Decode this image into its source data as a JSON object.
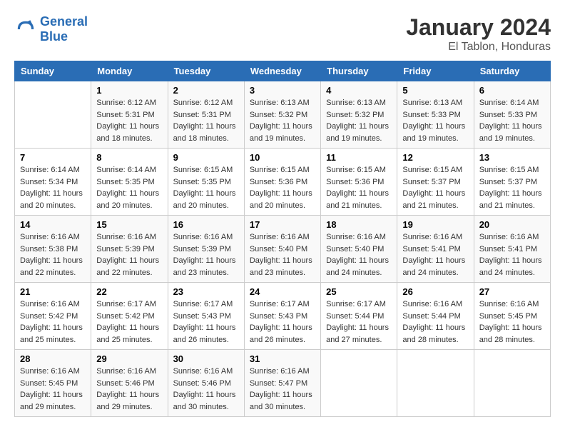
{
  "header": {
    "logo_line1": "General",
    "logo_line2": "Blue",
    "title": "January 2024",
    "subtitle": "El Tablon, Honduras"
  },
  "calendar": {
    "days_of_week": [
      "Sunday",
      "Monday",
      "Tuesday",
      "Wednesday",
      "Thursday",
      "Friday",
      "Saturday"
    ],
    "weeks": [
      [
        {
          "day": "",
          "info": ""
        },
        {
          "day": "1",
          "info": "Sunrise: 6:12 AM\nSunset: 5:31 PM\nDaylight: 11 hours\nand 18 minutes."
        },
        {
          "day": "2",
          "info": "Sunrise: 6:12 AM\nSunset: 5:31 PM\nDaylight: 11 hours\nand 18 minutes."
        },
        {
          "day": "3",
          "info": "Sunrise: 6:13 AM\nSunset: 5:32 PM\nDaylight: 11 hours\nand 19 minutes."
        },
        {
          "day": "4",
          "info": "Sunrise: 6:13 AM\nSunset: 5:32 PM\nDaylight: 11 hours\nand 19 minutes."
        },
        {
          "day": "5",
          "info": "Sunrise: 6:13 AM\nSunset: 5:33 PM\nDaylight: 11 hours\nand 19 minutes."
        },
        {
          "day": "6",
          "info": "Sunrise: 6:14 AM\nSunset: 5:33 PM\nDaylight: 11 hours\nand 19 minutes."
        }
      ],
      [
        {
          "day": "7",
          "info": "Sunrise: 6:14 AM\nSunset: 5:34 PM\nDaylight: 11 hours\nand 20 minutes."
        },
        {
          "day": "8",
          "info": "Sunrise: 6:14 AM\nSunset: 5:35 PM\nDaylight: 11 hours\nand 20 minutes."
        },
        {
          "day": "9",
          "info": "Sunrise: 6:15 AM\nSunset: 5:35 PM\nDaylight: 11 hours\nand 20 minutes."
        },
        {
          "day": "10",
          "info": "Sunrise: 6:15 AM\nSunset: 5:36 PM\nDaylight: 11 hours\nand 20 minutes."
        },
        {
          "day": "11",
          "info": "Sunrise: 6:15 AM\nSunset: 5:36 PM\nDaylight: 11 hours\nand 21 minutes."
        },
        {
          "day": "12",
          "info": "Sunrise: 6:15 AM\nSunset: 5:37 PM\nDaylight: 11 hours\nand 21 minutes."
        },
        {
          "day": "13",
          "info": "Sunrise: 6:15 AM\nSunset: 5:37 PM\nDaylight: 11 hours\nand 21 minutes."
        }
      ],
      [
        {
          "day": "14",
          "info": "Sunrise: 6:16 AM\nSunset: 5:38 PM\nDaylight: 11 hours\nand 22 minutes."
        },
        {
          "day": "15",
          "info": "Sunrise: 6:16 AM\nSunset: 5:39 PM\nDaylight: 11 hours\nand 22 minutes."
        },
        {
          "day": "16",
          "info": "Sunrise: 6:16 AM\nSunset: 5:39 PM\nDaylight: 11 hours\nand 23 minutes."
        },
        {
          "day": "17",
          "info": "Sunrise: 6:16 AM\nSunset: 5:40 PM\nDaylight: 11 hours\nand 23 minutes."
        },
        {
          "day": "18",
          "info": "Sunrise: 6:16 AM\nSunset: 5:40 PM\nDaylight: 11 hours\nand 24 minutes."
        },
        {
          "day": "19",
          "info": "Sunrise: 6:16 AM\nSunset: 5:41 PM\nDaylight: 11 hours\nand 24 minutes."
        },
        {
          "day": "20",
          "info": "Sunrise: 6:16 AM\nSunset: 5:41 PM\nDaylight: 11 hours\nand 24 minutes."
        }
      ],
      [
        {
          "day": "21",
          "info": "Sunrise: 6:16 AM\nSunset: 5:42 PM\nDaylight: 11 hours\nand 25 minutes."
        },
        {
          "day": "22",
          "info": "Sunrise: 6:17 AM\nSunset: 5:42 PM\nDaylight: 11 hours\nand 25 minutes."
        },
        {
          "day": "23",
          "info": "Sunrise: 6:17 AM\nSunset: 5:43 PM\nDaylight: 11 hours\nand 26 minutes."
        },
        {
          "day": "24",
          "info": "Sunrise: 6:17 AM\nSunset: 5:43 PM\nDaylight: 11 hours\nand 26 minutes."
        },
        {
          "day": "25",
          "info": "Sunrise: 6:17 AM\nSunset: 5:44 PM\nDaylight: 11 hours\nand 27 minutes."
        },
        {
          "day": "26",
          "info": "Sunrise: 6:16 AM\nSunset: 5:44 PM\nDaylight: 11 hours\nand 28 minutes."
        },
        {
          "day": "27",
          "info": "Sunrise: 6:16 AM\nSunset: 5:45 PM\nDaylight: 11 hours\nand 28 minutes."
        }
      ],
      [
        {
          "day": "28",
          "info": "Sunrise: 6:16 AM\nSunset: 5:45 PM\nDaylight: 11 hours\nand 29 minutes."
        },
        {
          "day": "29",
          "info": "Sunrise: 6:16 AM\nSunset: 5:46 PM\nDaylight: 11 hours\nand 29 minutes."
        },
        {
          "day": "30",
          "info": "Sunrise: 6:16 AM\nSunset: 5:46 PM\nDaylight: 11 hours\nand 30 minutes."
        },
        {
          "day": "31",
          "info": "Sunrise: 6:16 AM\nSunset: 5:47 PM\nDaylight: 11 hours\nand 30 minutes."
        },
        {
          "day": "",
          "info": ""
        },
        {
          "day": "",
          "info": ""
        },
        {
          "day": "",
          "info": ""
        }
      ]
    ]
  }
}
